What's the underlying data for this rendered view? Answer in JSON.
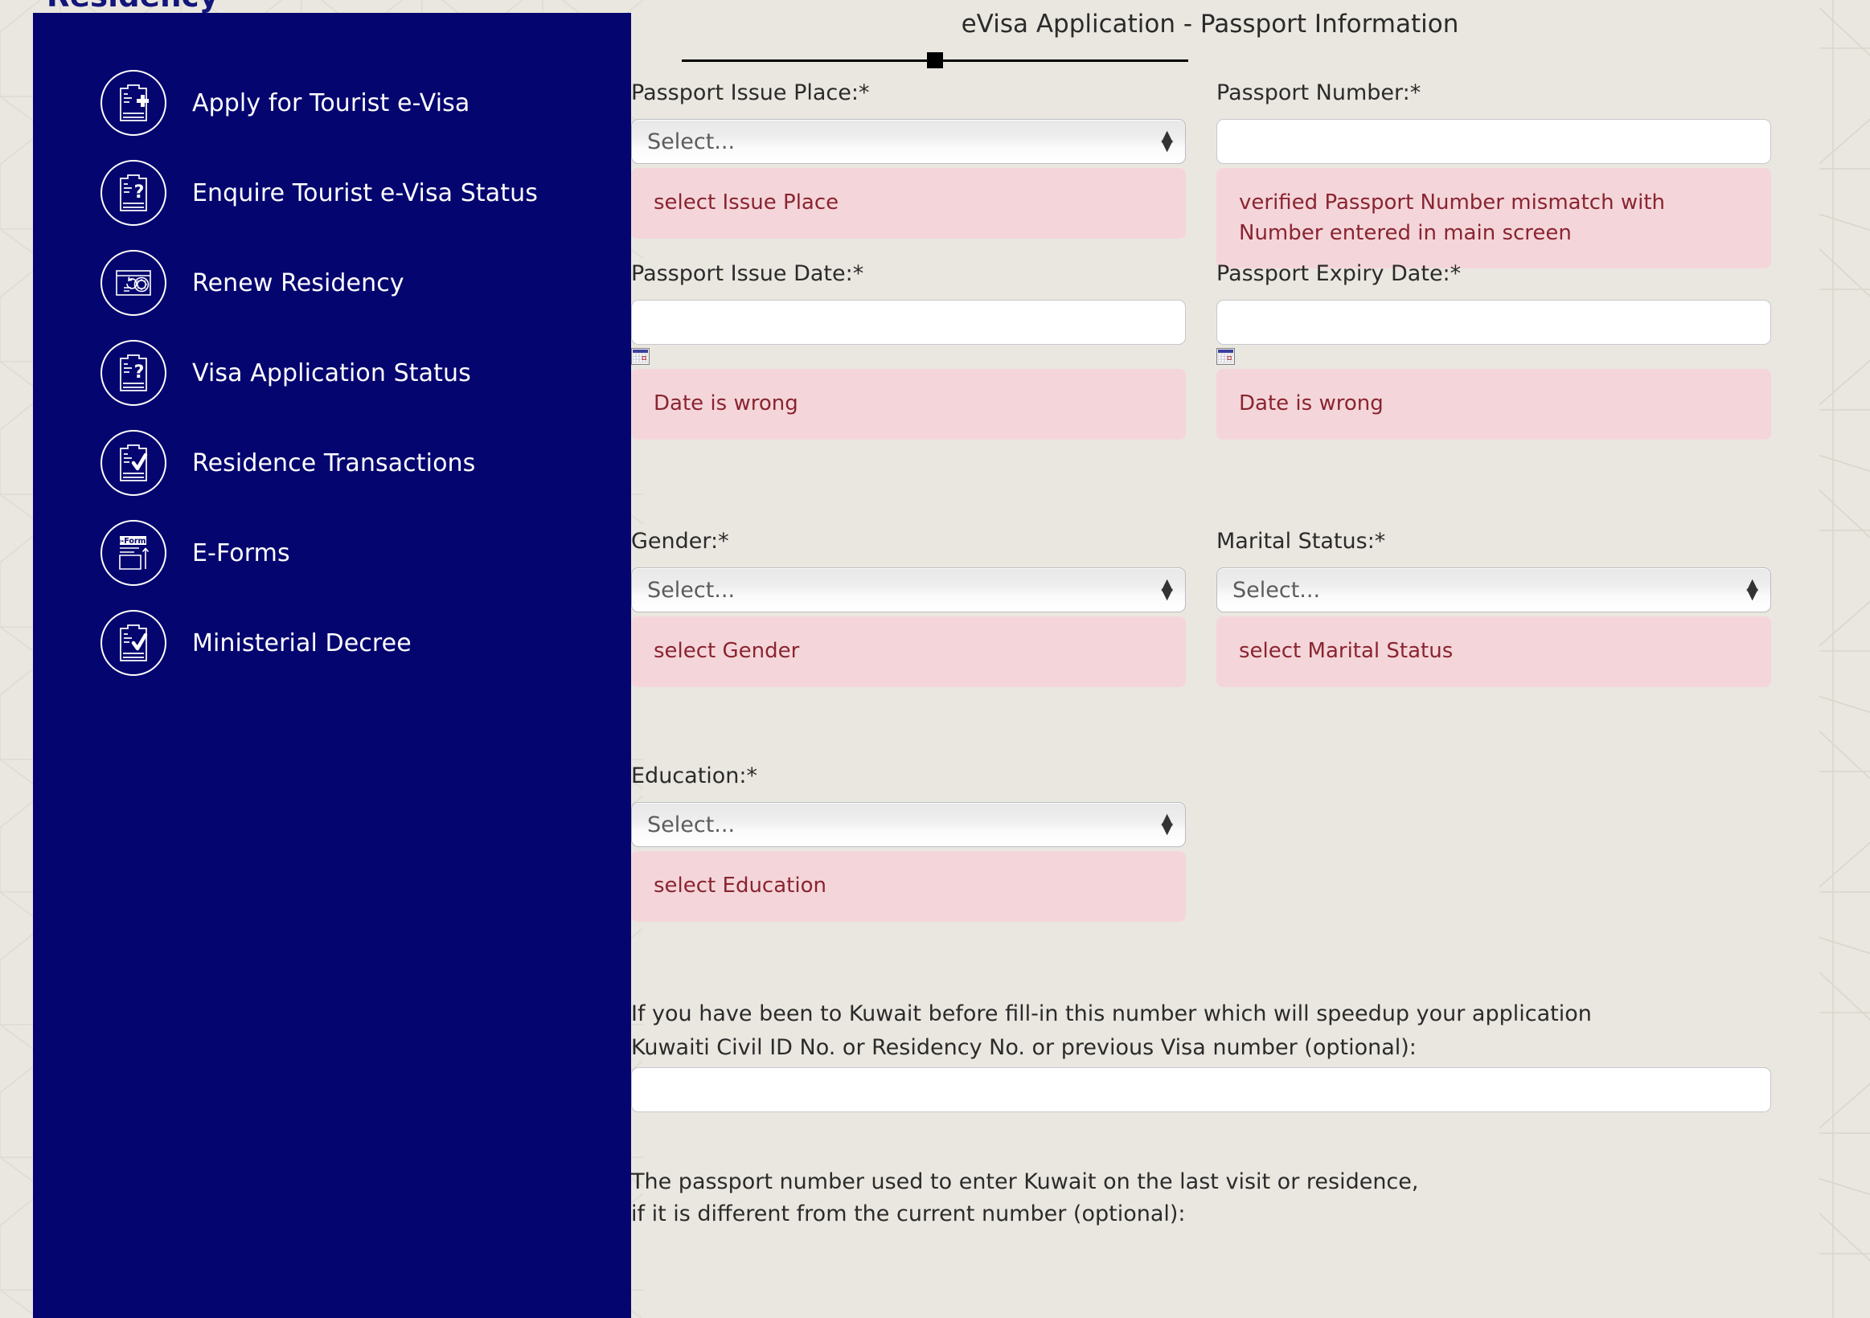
{
  "page": {
    "heading": "Residency",
    "background_color": "#eae7e0",
    "sidebar_color": "#050570",
    "error_bg_color": "#f4d6da",
    "error_text_color": "#8a2430"
  },
  "sidebar": {
    "items": [
      {
        "label": "Apply for Tourist e-Visa",
        "icon": "document-plus-icon"
      },
      {
        "label": "Enquire Tourist e-Visa Status",
        "icon": "document-question-icon"
      },
      {
        "label": "Renew Residency",
        "icon": "id-card-refresh-icon"
      },
      {
        "label": "Visa Application Status",
        "icon": "document-question-icon"
      },
      {
        "label": "Residence Transactions",
        "icon": "document-check-icon"
      },
      {
        "label": "E-Forms",
        "icon": "e-forms-upload-icon"
      },
      {
        "label": "Ministerial Decree",
        "icon": "document-check-icon"
      }
    ]
  },
  "form": {
    "title": "eVisa Application - Passport Information",
    "progress": {
      "marker_position_percent": 48
    },
    "fields": {
      "passport_issue_place": {
        "label": "Passport Issue Place:*",
        "control": "select",
        "value": "Select...",
        "error": "select Issue Place"
      },
      "passport_number": {
        "label": "Passport Number:*",
        "control": "text",
        "value": "",
        "placeholder": "",
        "error": "verified Passport Number mismatch with Number entered in main screen"
      },
      "passport_issue_date": {
        "label": "Passport Issue Date:*",
        "control": "text",
        "value": "",
        "placeholder": "",
        "icon": "calendar-icon",
        "error": "Date is wrong"
      },
      "passport_expiry_date": {
        "label": "Passport Expiry Date:*",
        "control": "text",
        "value": "",
        "placeholder": "",
        "icon": "calendar-icon",
        "error": "Date is wrong"
      },
      "gender": {
        "label": "Gender:*",
        "control": "select",
        "value": "Select...",
        "error": "select Gender"
      },
      "marital_status": {
        "label": "Marital Status:*",
        "control": "select",
        "value": "Select...",
        "error": "select Marital Status"
      },
      "education": {
        "label": "Education:*",
        "control": "select",
        "value": "Select...",
        "error": "select Education"
      },
      "previous_number": {
        "note_line_1": "If you have been to Kuwait before fill-in this number which will speedup your application",
        "note_line_2": "Kuwaiti Civil ID No. or Residency No. or previous Visa number (optional):",
        "control": "text",
        "value": "",
        "placeholder": ""
      },
      "previous_passport_number": {
        "note_line_1": "The passport number used to enter Kuwait on the last visit or residence,",
        "note_line_2": "if it is different from the current number (optional):"
      }
    }
  }
}
